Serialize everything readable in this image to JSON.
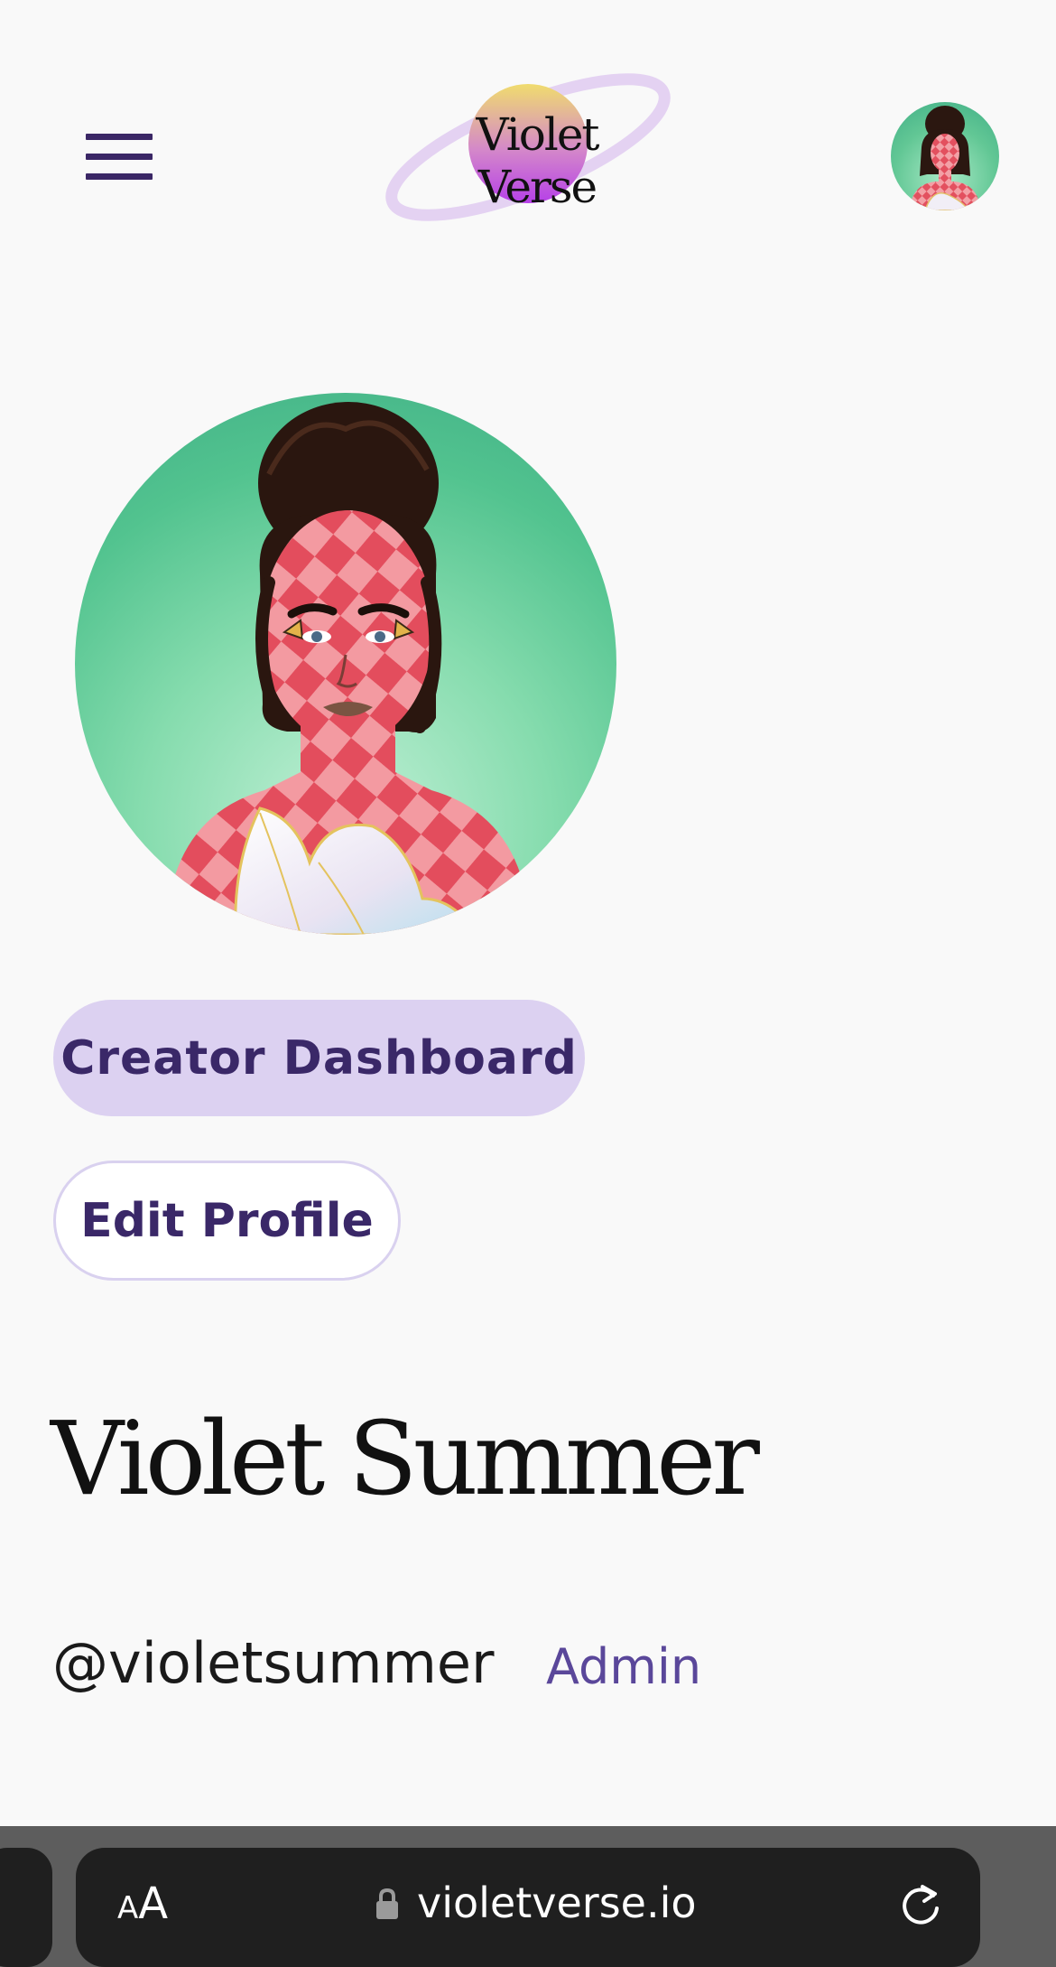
{
  "header": {
    "logo_text": "Violet Verse",
    "menu_icon": "hamburger-menu-icon",
    "avatar_icon": "user-avatar"
  },
  "profile": {
    "display_name": "Violet Summer",
    "handle": "@violetsummer",
    "role": "Admin"
  },
  "actions": {
    "dashboard_label": "Creator Dashboard",
    "edit_label": "Edit Profile"
  },
  "browser": {
    "text_size_small": "A",
    "text_size_big": "A",
    "url": "violetverse.io",
    "lock_icon": "lock-icon",
    "reload_icon": "reload-icon"
  },
  "colors": {
    "background": "#f9f9f9",
    "accent_purple": "#3a2868",
    "dashboard_button_bg": "#dcd1f1",
    "role_text": "#5a479a",
    "browser_bar": "#5d5d5d",
    "url_field": "#1f1f1f"
  }
}
